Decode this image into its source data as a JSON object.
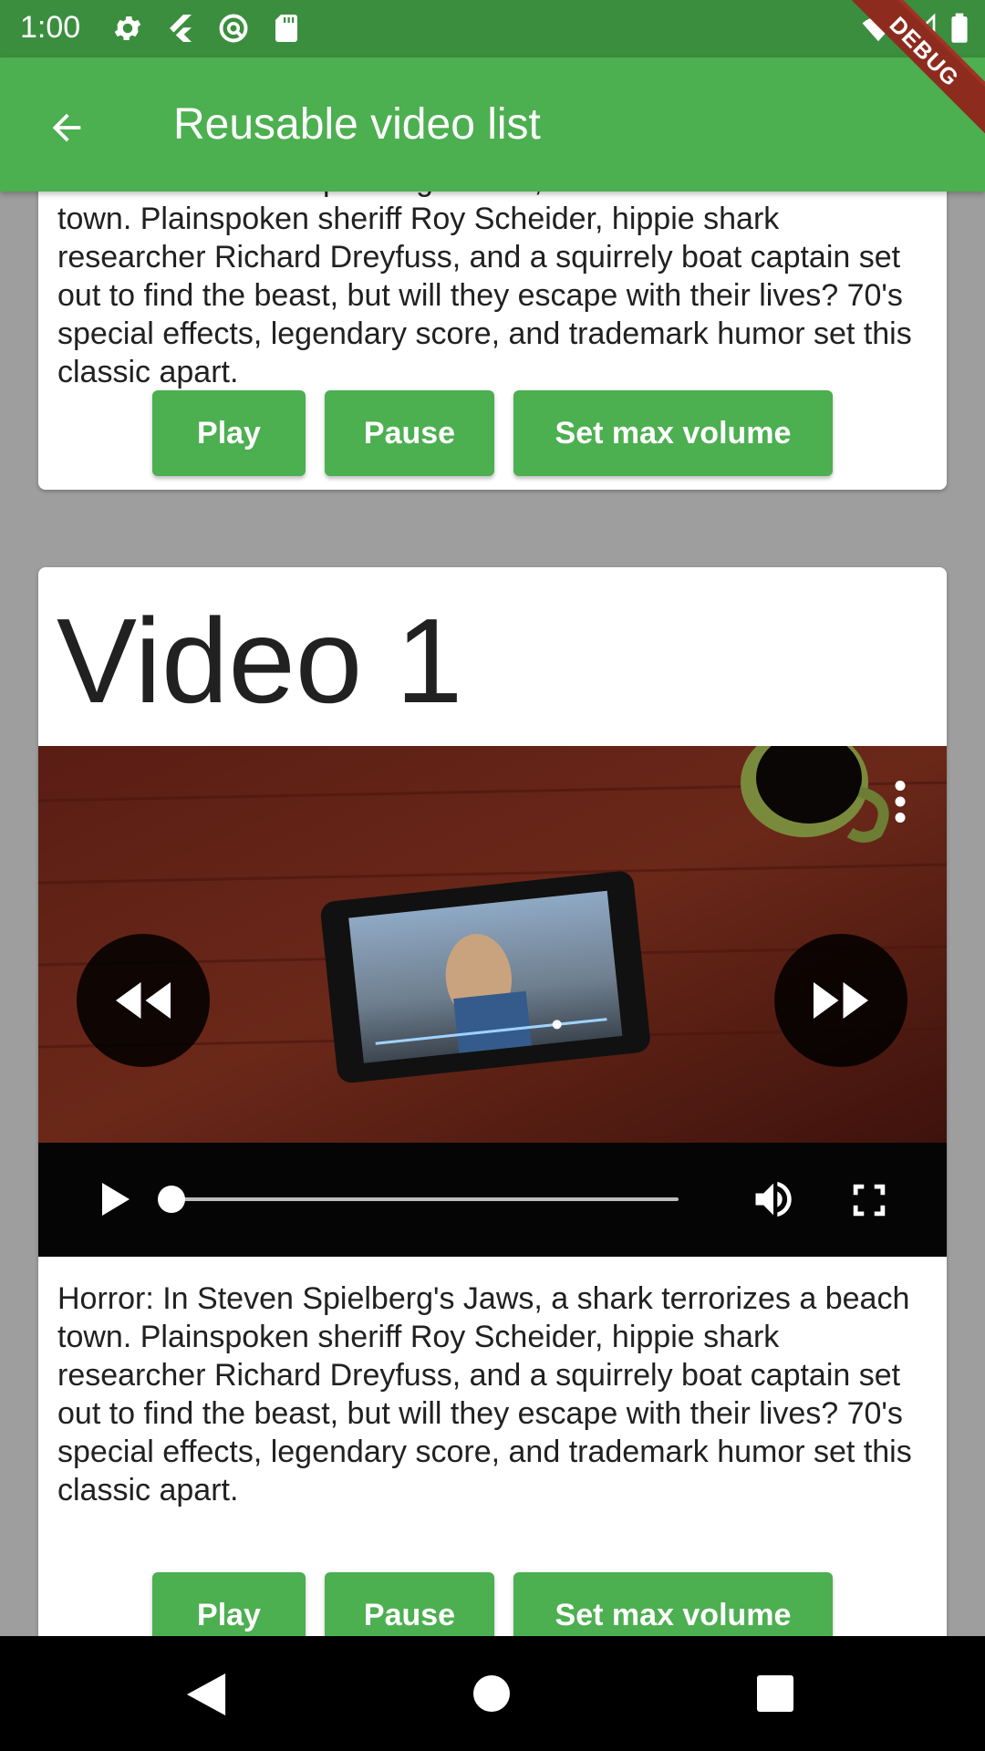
{
  "status_bar": {
    "time": "1:00",
    "left_icons": [
      "settings-icon",
      "flutter-icon",
      "sync-icon",
      "sd-card-icon"
    ],
    "right_icons": [
      "wifi-icon",
      "signal-icon",
      "battery-icon"
    ]
  },
  "debug_banner": "DEBUG",
  "app_bar": {
    "title": "Reusable video list",
    "back_icon": "arrow-back-icon"
  },
  "cards": [
    {
      "description": "Horror: In Steven Spielberg's Jaws, a shark terrorizes a beach town. Plainspoken sheriff Roy Scheider, hippie shark researcher Richard Dreyfuss, and a squirrely boat captain set out to find the beast, but will they escape with their lives? 70's special effects, legendary score, and trademark humor set this classic apart.",
      "buttons": {
        "play": "Play",
        "pause": "Pause",
        "max_volume": "Set max volume"
      }
    },
    {
      "title": "Video 1",
      "player": {
        "progress": 0.0,
        "icons": [
          "rewind-icon",
          "fast-forward-icon",
          "more-vert-icon",
          "play-icon",
          "volume-icon",
          "fullscreen-icon"
        ]
      },
      "description": "Horror: In Steven Spielberg's Jaws, a shark terrorizes a beach town. Plainspoken sheriff Roy Scheider, hippie shark researcher Richard Dreyfuss, and a squirrely boat captain set out to find the beast, but will they escape with their lives? 70's special effects, legendary score, and trademark humor set this classic apart.",
      "buttons": {
        "play": "Play",
        "pause": "Pause",
        "max_volume": "Set max volume"
      }
    }
  ],
  "colors": {
    "app_bar": "#4caf50",
    "status_bar": "#3b8e3e",
    "button": "#4caf50",
    "background": "#9e9e9e",
    "debug_banner": "#8e2b1f"
  },
  "nav_bar": {
    "icons": [
      "nav-back-icon",
      "nav-home-icon",
      "nav-recents-icon"
    ]
  }
}
